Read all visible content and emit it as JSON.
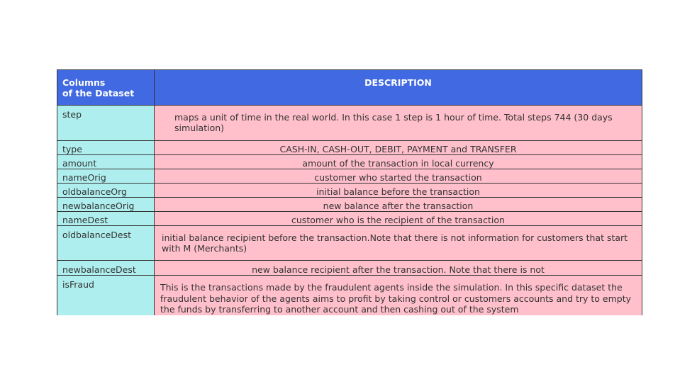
{
  "header": {
    "col1_line1": "Columns",
    "col1_line2": "of the Dataset",
    "col2": "DESCRIPTION"
  },
  "rows": [
    {
      "name": "step",
      "description": "maps a unit of time in the real world. In this case 1 step is 1 hour of time. Total steps 744 (30 days simulation)"
    },
    {
      "name": "type",
      "description": "CASH-IN, CASH-OUT, DEBIT, PAYMENT and TRANSFER"
    },
    {
      "name": "amount",
      "description": "amount of the transaction in local currency"
    },
    {
      "name": "nameOrig",
      "description": "customer who started the transaction"
    },
    {
      "name": "oldbalanceOrg",
      "description": "initial balance before the transaction"
    },
    {
      "name": "newbalanceOrig",
      "description": "new balance after the transaction"
    },
    {
      "name": "nameDest",
      "description": "customer who is the recipient of the transaction"
    },
    {
      "name": "oldbalanceDest",
      "description": "initial balance recipient before the transaction.Note that there is not information for customers that start with M (Merchants)"
    },
    {
      "name": "newbalanceDest",
      "description": "new balance recipient after the transaction. Note that there is not"
    },
    {
      "name": "isFraud",
      "description": "This is the transactions made by the fraudulent agents inside the simulation. In this specific dataset the fraudulent behavior of the agents aims to profit by taking control or customers accounts and try to empty the funds by transferring to another account and then cashing out of the system"
    }
  ],
  "colors": {
    "header_bg": "#4169e1",
    "name_bg": "#afeeee",
    "desc_bg": "#ffc0cb"
  }
}
